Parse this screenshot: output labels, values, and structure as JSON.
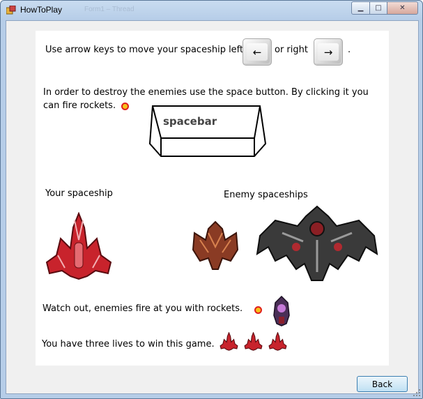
{
  "window": {
    "title": "HowToPlay",
    "background_title": "Form1  –  Thread",
    "controls": {
      "minimize": "▁",
      "maximize": "□",
      "close": "✕"
    }
  },
  "instructions": {
    "move_prefix": "Use arrow keys to move your spaceship left",
    "move_middle": "or right",
    "move_suffix": ".",
    "left_key": "←",
    "right_key": "→",
    "fire_text": "In order to destroy the enemies use the space button. By clicking it you can fire rockets.",
    "spacebar_label": "spacebar",
    "your_spaceship_label": "Your spaceship",
    "enemy_spaceships_label": "Enemy spaceships",
    "enemy_fire_text": "Watch out, enemies fire at you with rockets.",
    "lives_text": "You have three lives to win this game."
  },
  "lives_count": 3,
  "buttons": {
    "back": "Back"
  },
  "colors": {
    "player_ship": "#c8232c",
    "enemy_small": "#8a3b24",
    "enemy_large": "#3a3a3a",
    "rocket_fill": "#f7c21a",
    "rocket_ring": "#e01e1e"
  }
}
